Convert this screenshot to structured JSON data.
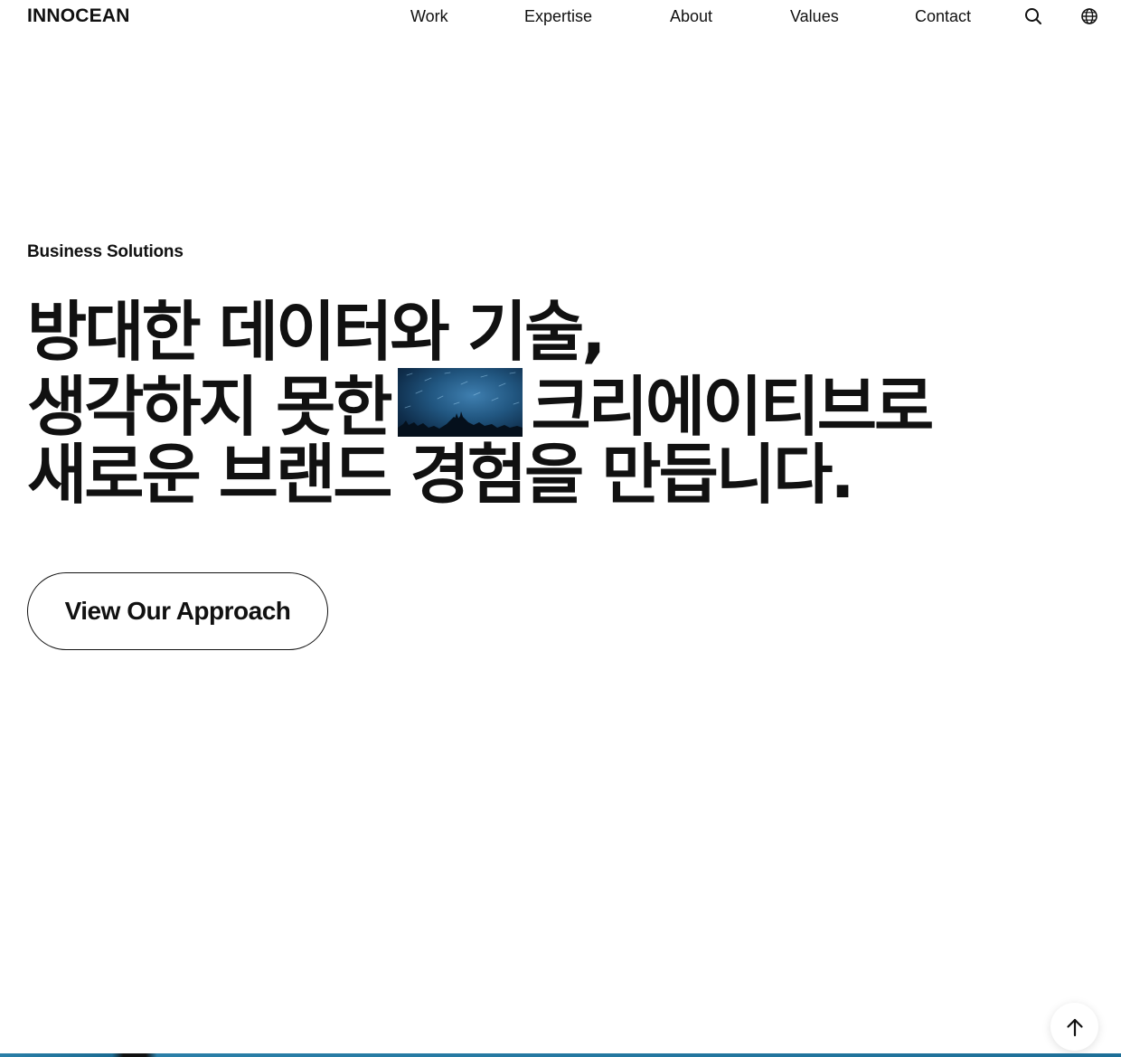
{
  "header": {
    "logo": "INNOCEAN",
    "nav": {
      "work": "Work",
      "expertise": "Expertise",
      "about": "About",
      "values": "Values",
      "contact": "Contact"
    },
    "icons": {
      "search": "search-icon",
      "language": "globe-icon"
    }
  },
  "hero": {
    "eyebrow": "Business Solutions",
    "line1": "방대한 데이터와 기술,",
    "line2_before": "생각하지 못한",
    "line2_after": "크리에이티브로",
    "line3": "새로운 브랜드 경험을 만듭니다.",
    "inline_image": "night-sky-star-trails-photo",
    "cta_label": "View Our Approach"
  },
  "scroll_top": {
    "icon": "arrow-up-icon"
  },
  "colors": {
    "text": "#111111",
    "background": "#ffffff",
    "accent_strip": "#2a7fa8"
  }
}
